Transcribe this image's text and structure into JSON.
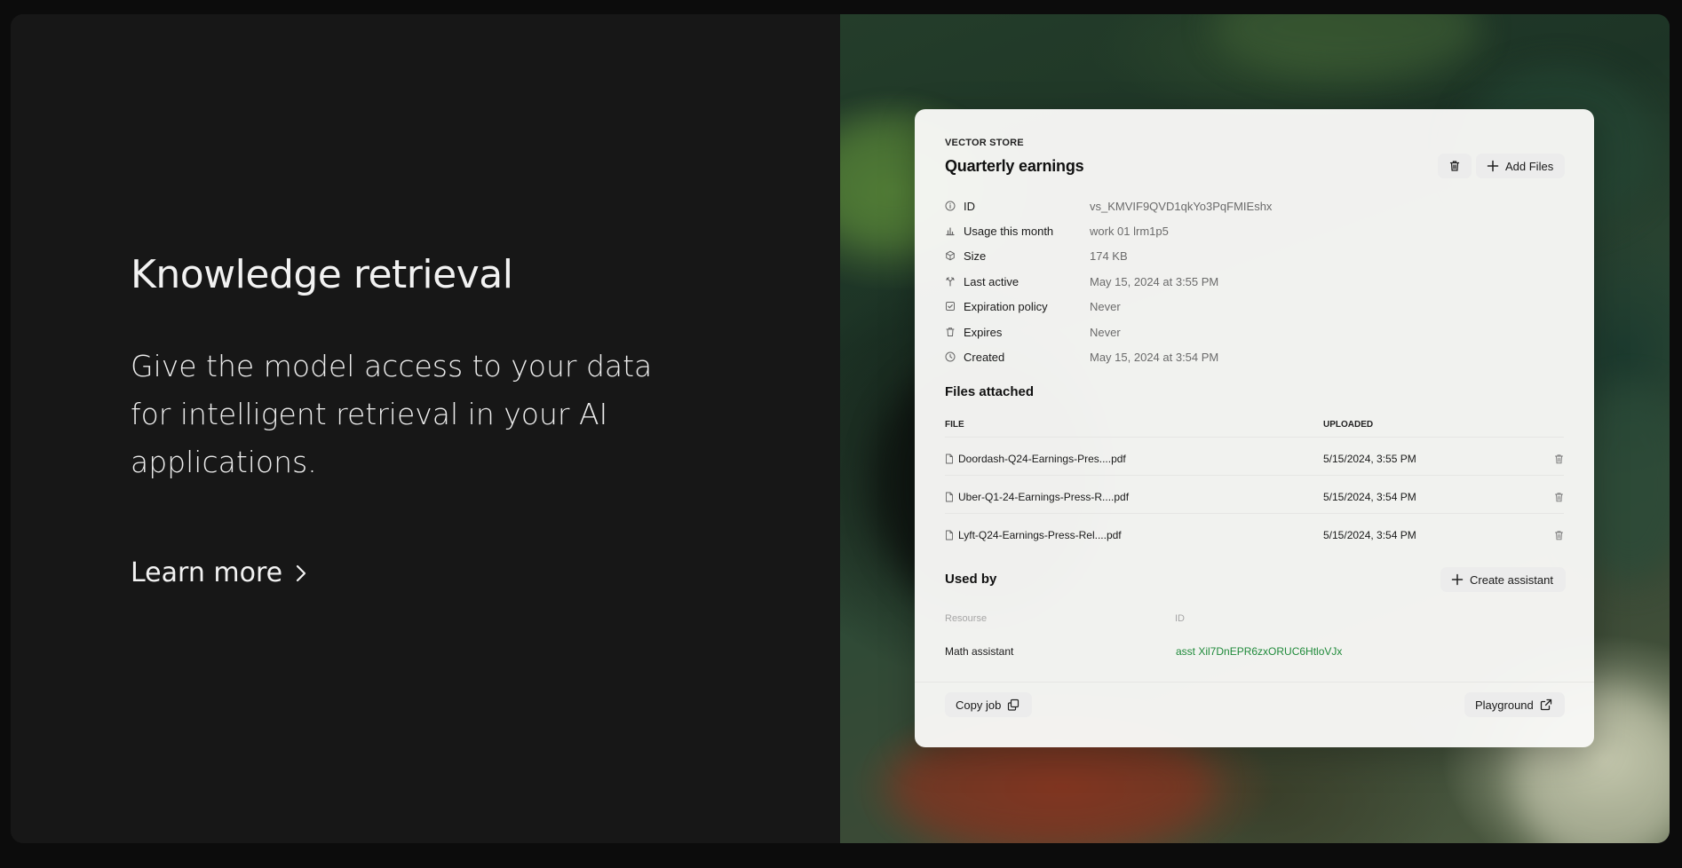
{
  "hero": {
    "heading": "Knowledge retrieval",
    "description": "Give the model access to your data for intelligent retrieval in your AI applications.",
    "learn_more": "Learn more"
  },
  "card": {
    "eyebrow": "VECTOR STORE",
    "title": "Quarterly earnings",
    "add_files_label": "Add Files",
    "meta": [
      {
        "icon": "info-icon",
        "label": "ID",
        "value": "vs_KMVIF9QVD1qkYo3PqFMIEshx"
      },
      {
        "icon": "bar-chart-icon",
        "label": "Usage this month",
        "value": "work  01  lrm1p5"
      },
      {
        "icon": "cube-icon",
        "label": "Size",
        "value": "174 KB"
      },
      {
        "icon": "activity-icon",
        "label": "Last active",
        "value": "May 15, 2024 at 3:55 PM"
      },
      {
        "icon": "calendar-check-icon",
        "label": "Expiration policy",
        "value": "Never"
      },
      {
        "icon": "trash-icon",
        "label": "Expires",
        "value": "Never"
      },
      {
        "icon": "clock-icon",
        "label": "Created",
        "value": "May 15, 2024 at 3:54 PM"
      }
    ],
    "files": {
      "title": "Files attached",
      "col_file": "FILE",
      "col_uploaded": "UPLOADED",
      "rows": [
        {
          "name": "Doordash-Q24-Earnings-Pres....pdf",
          "uploaded": "5/15/2024, 3:55 PM"
        },
        {
          "name": "Uber-Q1-24-Earnings-Press-R....pdf",
          "uploaded": "5/15/2024, 3:54 PM"
        },
        {
          "name": "Lyft-Q24-Earnings-Press-Rel....pdf",
          "uploaded": "5/15/2024, 3:54 PM"
        }
      ]
    },
    "used_by": {
      "title": "Used by",
      "create_label": "Create assistant",
      "col_resource": "Resourse",
      "col_id": "ID",
      "rows": [
        {
          "resource": "Math assistant",
          "id": "asst  Xil7DnEPR6zxORUC6HtloVJx"
        }
      ]
    },
    "footer": {
      "copy_label": "Copy job",
      "playground_label": "Playground"
    }
  },
  "colors": {
    "panel_bg": "#171717",
    "card_bg": "#f8f8f6",
    "accent_green": "#1f8a3a"
  }
}
